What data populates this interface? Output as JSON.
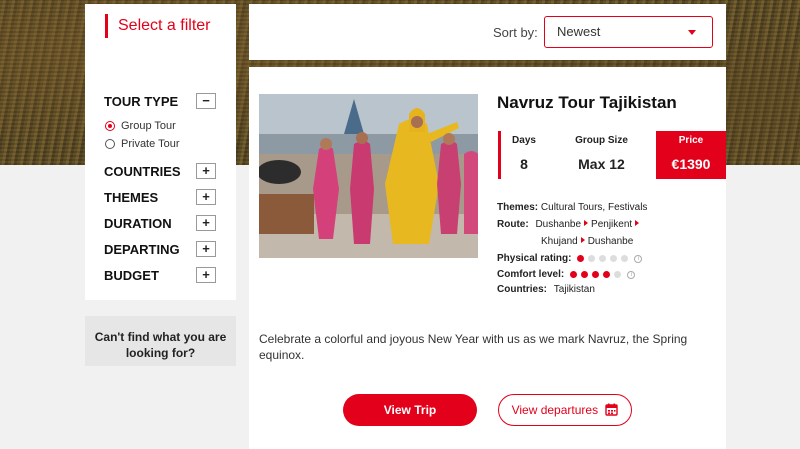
{
  "filters": {
    "title": "Select a filter",
    "tour_type": {
      "label": "TOUR TYPE",
      "toggle": "−",
      "options": [
        {
          "label": "Group Tour",
          "checked": true
        },
        {
          "label": "Private Tour",
          "checked": false
        }
      ]
    },
    "sections": [
      {
        "label": "COUNTRIES",
        "toggle": "+"
      },
      {
        "label": "THEMES",
        "toggle": "+"
      },
      {
        "label": "DURATION",
        "toggle": "+"
      },
      {
        "label": "DEPARTING",
        "toggle": "+"
      },
      {
        "label": "BUDGET",
        "toggle": "+"
      }
    ],
    "help": "Can't find what you are looking for?"
  },
  "sort": {
    "label": "Sort by:",
    "selected": "Newest"
  },
  "trip": {
    "title": "Navruz Tour Tajikistan",
    "stats": {
      "days_label": "Days",
      "days_value": "8",
      "group_label": "Group Size",
      "group_value": "Max 12",
      "price_label": "Price",
      "price_value": "€1390"
    },
    "themes_label": "Themes:",
    "themes_value": "Cultural Tours, Festivals",
    "route_label": "Route:",
    "route": [
      "Dushanbe",
      "Penjikent",
      "Khujand",
      "Dushanbe"
    ],
    "physical_label": "Physical rating:",
    "physical_rating": 1,
    "comfort_label": "Comfort level:",
    "comfort_rating": 4,
    "rating_max": 5,
    "countries_label": "Countries:",
    "countries_value": "Tajikistan",
    "description": "Celebrate a colorful and joyous New Year with us as we mark Navruz, the Spring equinox.",
    "view_button": "View Trip",
    "departures_button": "View departures"
  },
  "colors": {
    "accent": "#e3001b",
    "panel": "#ffffff",
    "background": "#f1f1f1"
  },
  "icons": [
    "radio-icon",
    "caret-down-icon",
    "arrow-right-icon",
    "info-icon",
    "calendar-icon"
  ]
}
